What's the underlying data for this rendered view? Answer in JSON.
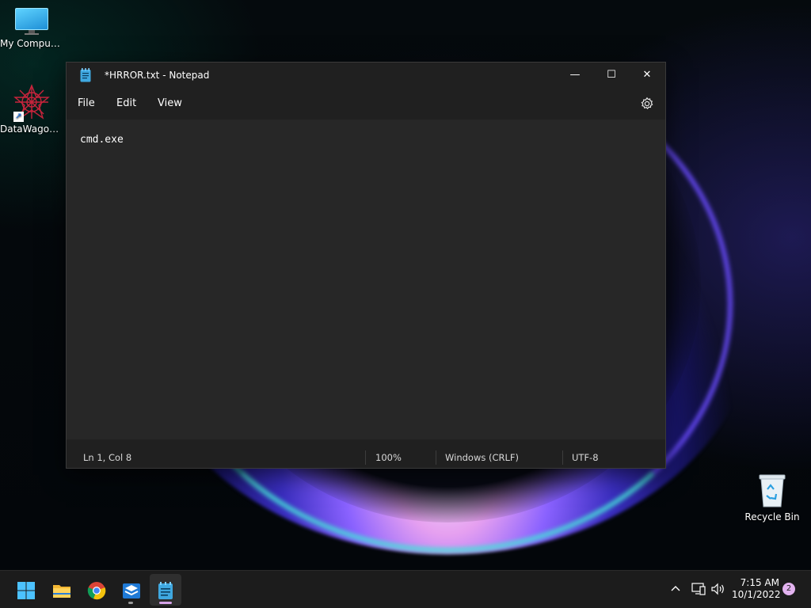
{
  "desktop": {
    "icons": [
      {
        "label": "My Computer",
        "icon": "computer-icon"
      },
      {
        "label": "DataWagon...",
        "icon": "datawagon-icon"
      },
      {
        "label": "Recycle Bin",
        "icon": "recycle-bin-icon"
      }
    ]
  },
  "window": {
    "title": "*HRROR.txt - Notepad",
    "controls": {
      "minimize": "—",
      "maximize": "☐",
      "close": "✕"
    },
    "menu": [
      "File",
      "Edit",
      "View"
    ],
    "content": "cmd.exe",
    "status": {
      "position": "Ln 1, Col 8",
      "zoom": "100%",
      "line_ending": "Windows (CRLF)",
      "encoding": "UTF-8"
    }
  },
  "taskbar": {
    "apps": [
      "start-icon",
      "file-explorer-icon",
      "chrome-icon",
      "app-box-icon",
      "notepad-icon"
    ],
    "active_app": "notepad-icon",
    "clock_time": "7:15 AM",
    "clock_date": "10/1/2022",
    "notification_count": "2"
  },
  "colors": {
    "accent": "#4cc2ff",
    "notepad_underline": "#d6a3e8",
    "badge": "#e3b3f0"
  }
}
